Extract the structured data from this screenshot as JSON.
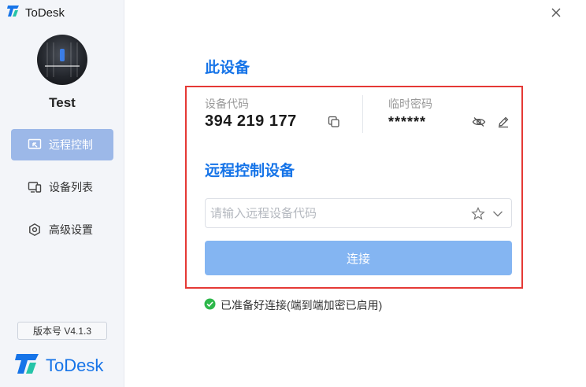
{
  "app": {
    "title": "ToDesk",
    "brand": "ToDesk"
  },
  "colors": {
    "accent": "#1674e8",
    "nav_active": "#9cb8e8",
    "connect_button": "#84b5f2",
    "status_ok": "#2eb84b",
    "highlight_frame": "#e53935"
  },
  "user": {
    "name": "Test"
  },
  "sidebar": {
    "items": [
      {
        "label": "远程控制",
        "icon": "remote-control-icon",
        "active": true
      },
      {
        "label": "设备列表",
        "icon": "device-list-icon",
        "active": false
      },
      {
        "label": "高级设置",
        "icon": "settings-icon",
        "active": false
      }
    ],
    "version": "版本号 V4.1.3"
  },
  "this_device": {
    "title": "此设备",
    "code_label": "设备代码",
    "code": "394 219 177",
    "password_label": "临时密码",
    "password": "******"
  },
  "remote": {
    "title": "远程控制设备",
    "input_placeholder": "请输入远程设备代码",
    "input_value": "",
    "connect_label": "连接"
  },
  "status": {
    "text": "已准备好连接(端到端加密已启用)"
  }
}
